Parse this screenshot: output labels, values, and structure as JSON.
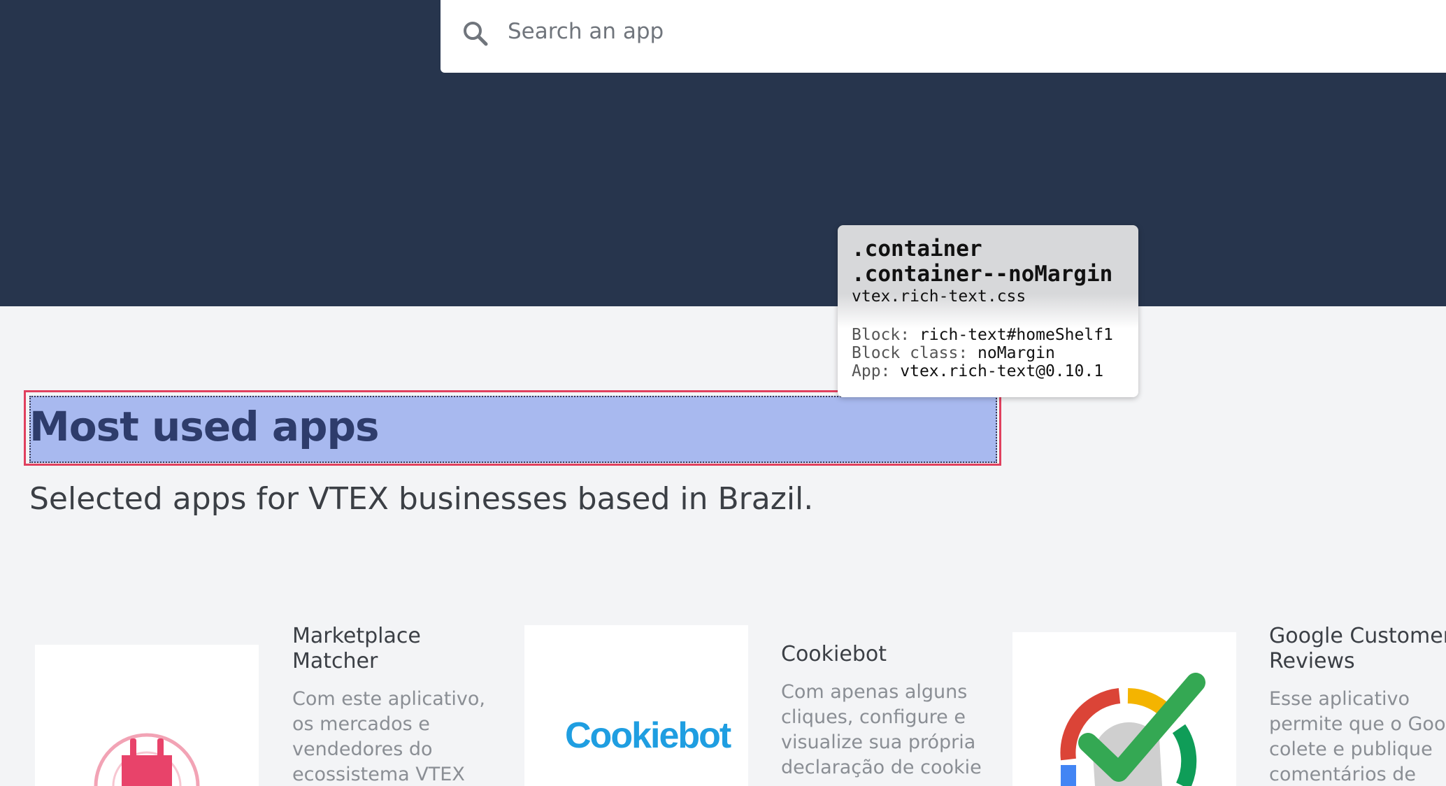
{
  "search": {
    "placeholder": "Search an app",
    "icon": "search-icon"
  },
  "tooltip": {
    "class_line_1": ".container",
    "class_line_2": ".container--noMargin",
    "file": "vtex.rich-text.css",
    "rows": [
      {
        "key": "Block:",
        "value": "rich-text#homeShelf1"
      },
      {
        "key": "Block class:",
        "value": "noMargin"
      },
      {
        "key": "App:",
        "value": "vtex.rich-text@0.10.1"
      }
    ]
  },
  "section": {
    "title": "Most used apps",
    "subtitle": "Selected apps for VTEX businesses based in Brazil."
  },
  "cards": [
    {
      "title_lines": [
        "Marketplace",
        "Matcher"
      ],
      "desc_lines": [
        "Com este aplicativo,",
        "os mercados e",
        "vendedores do",
        "ecossistema VTEX"
      ],
      "icon": "plug-icon"
    },
    {
      "title_lines": [
        "Cookiebot"
      ],
      "desc_lines": [
        "Com apenas alguns",
        "cliques, configure e",
        "visualize sua própria",
        "declaração de cookie"
      ],
      "logo_text": "Cookiebot",
      "icon": "cookiebot-logo"
    },
    {
      "title_lines": [
        "Google Customer",
        "Reviews"
      ],
      "desc_lines": [
        "Esse aplicativo",
        "permite que o Goog",
        "colete e publique",
        "comentários de"
      ],
      "icon": "google-check-icon"
    }
  ],
  "colors": {
    "hero": "#27354d",
    "background": "#f3f4f6",
    "highlight_fill": "#a8b9ef",
    "highlight_border": "#e0405e",
    "title": "#2e3c6b",
    "plug": "#e8436a",
    "cookiebot": "#1f9ee1"
  }
}
